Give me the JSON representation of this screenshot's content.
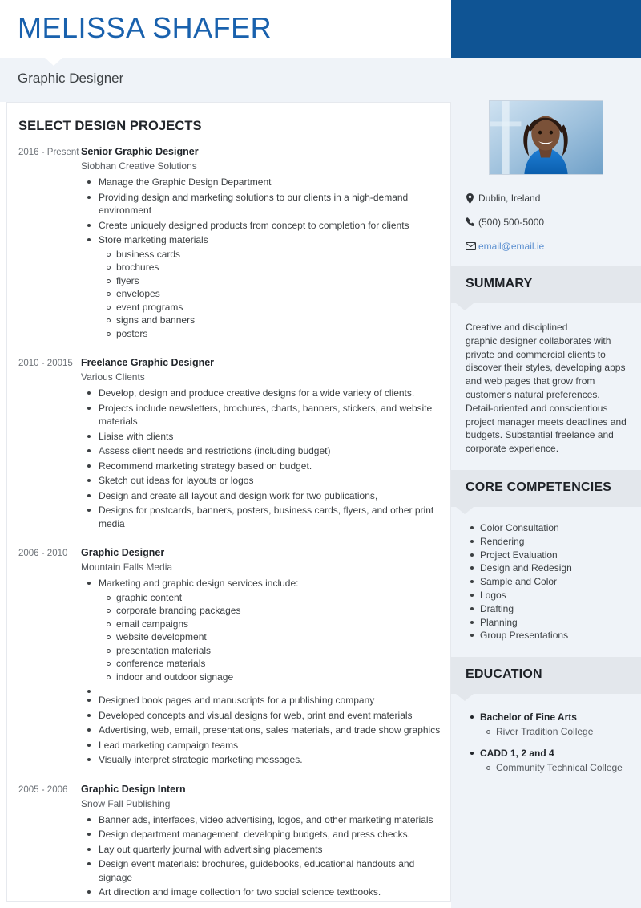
{
  "header": {
    "name": "MELISSA SHAFER",
    "job_title": "Graphic Designer",
    "accent_blue": "#0f5494",
    "name_color": "#1961ad"
  },
  "main": {
    "section_title": "SELECT DESIGN PROJECTS",
    "jobs": [
      {
        "dates": "2016 - Present",
        "role": "Senior Graphic Designer",
        "company": "Siobhan Creative Solutions",
        "bullets": [
          {
            "text": "Manage the Graphic Design Department"
          },
          {
            "text": "Providing design and marketing solutions to our clients in a  high-demand environment"
          },
          {
            "text": "Create uniquely designed products from concept to completion for clients"
          },
          {
            "text": "Store marketing materials",
            "sub": [
              "business cards",
              "brochures",
              "flyers",
              "envelopes",
              "event programs",
              "signs and banners",
              "posters"
            ]
          }
        ]
      },
      {
        "dates": "2010 - 20015",
        "role": "Freelance Graphic Designer",
        "company": "Various Clients",
        "bullets": [
          {
            "text": "Develop, design and produce creative  designs for a wide variety of clients."
          },
          {
            "text": "Projects include newsletters, brochures, charts, banners, stickers, and website materials"
          },
          {
            "text": "Liaise with clients"
          },
          {
            "text": "Assess client needs and restrictions (including budget)"
          },
          {
            "text": "Recommend marketing strategy based on budget."
          },
          {
            "text": "Sketch out ideas for layouts or logos"
          },
          {
            "text": "Design and create all layout and design work for two publications,"
          },
          {
            "text": "Designs for postcards, banners, posters, business cards, flyers, and other print media"
          }
        ]
      },
      {
        "dates": "2006 - 2010",
        "role": "Graphic Designer",
        "company": "Mountain Falls Media",
        "bullets": [
          {
            "text": "Marketing and graphic design services include:",
            "sub": [
              "graphic content",
              "corporate branding packages",
              "email campaigns",
              "website development",
              "presentation materials",
              "conference materials",
              "indoor and outdoor signage"
            ],
            "gap_after": true
          },
          {
            "text": "Designed book pages and manuscripts for a publishing company"
          },
          {
            "text": "Developed concepts and visual designs for web, print and event materials"
          },
          {
            "text": "Advertising, web, email, presentations, sales  materials, and trade show graphics"
          },
          {
            "text": "Lead marketing campaign teams"
          },
          {
            "text": "Visually interpret strategic marketing messages."
          }
        ]
      },
      {
        "dates": "2005 - 2006",
        "role": "Graphic Design Intern",
        "company": "Snow Fall Publishing",
        "bullets": [
          {
            "text": "Banner ads, interfaces, video advertising, logos, and other marketing materials"
          },
          {
            "text": "Design department management, developing budgets, and  press checks."
          },
          {
            "text": "Lay out quarterly journal with advertising placements"
          },
          {
            "text": "Design event materials: brochures, guidebooks, educational handouts and signage"
          },
          {
            "text": "Art direction  and image collection for two  social science textbooks."
          }
        ]
      }
    ]
  },
  "sidebar": {
    "contact": [
      {
        "icon": "location-pin-icon",
        "text": "Dublin, Ireland",
        "is_link": false
      },
      {
        "icon": "phone-icon",
        "text": "(500) 500-5000",
        "is_link": false
      },
      {
        "icon": "envelope-icon",
        "text": "email@email.ie",
        "is_link": true
      }
    ],
    "summary": {
      "heading": "SUMMARY",
      "text": "Creative and disciplined\ngraphic designer collaborates with private and commercial clients to discover their styles, developing apps and web pages that grow from customer's natural preferences. Detail-oriented and conscientious project manager meets deadlines and budgets. Substantial freelance and corporate experience."
    },
    "competencies": {
      "heading": "CORE COMPETENCIES",
      "items": [
        "Color Consultation",
        "Rendering",
        "Project Evaluation",
        "Design and Redesign",
        "Sample and Color",
        "Logos",
        "Drafting",
        "Planning",
        "Group Presentations"
      ]
    },
    "education": {
      "heading": "EDUCATION",
      "items": [
        {
          "degree": "Bachelor of Fine Arts",
          "school": "River Tradition College"
        },
        {
          "degree": "CADD 1, 2 and 4",
          "school": "Community Technical College"
        }
      ]
    },
    "link_color": "#5b8fd0"
  }
}
